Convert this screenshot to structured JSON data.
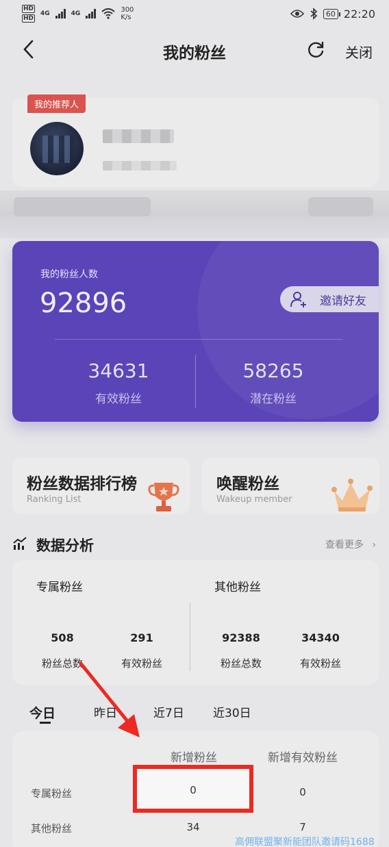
{
  "status_bar": {
    "net_hd1": "HD",
    "net_hd2": "HD",
    "net_4g1": "4G",
    "net_4g2": "4G",
    "speed_value": "300",
    "speed_unit": "K/s",
    "battery": "60",
    "time": "22:20"
  },
  "nav": {
    "title": "我的粉丝",
    "close_label": "关闭"
  },
  "referrer": {
    "tag": "我的推荐人"
  },
  "fans": {
    "label": "我的粉丝人数",
    "total": "92896",
    "invite_label": "邀请好友",
    "effective_value": "34631",
    "effective_label": "有效粉丝",
    "potential_value": "58265",
    "potential_label": "潜在粉丝"
  },
  "entries": {
    "ranking": {
      "title": "粉丝数据排行榜",
      "subtitle": "Ranking List"
    },
    "wakeup": {
      "title": "唤醒粉丝",
      "subtitle": "Wakeup member"
    }
  },
  "analysis": {
    "title": "数据分析",
    "see_more": "查看更多",
    "exclusive": {
      "header": "专属粉丝",
      "total_value": "508",
      "total_label": "粉丝总数",
      "effective_value": "291",
      "effective_label": "有效粉丝"
    },
    "other": {
      "header": "其他粉丝",
      "total_value": "92388",
      "total_label": "粉丝总数",
      "effective_value": "34340",
      "effective_label": "有效粉丝"
    }
  },
  "tabs": [
    "今日",
    "昨日",
    "近7日",
    "近30日"
  ],
  "table": {
    "col_new": "新增粉丝",
    "col_new_effective": "新增有效粉丝",
    "rows": [
      {
        "label": "专属粉丝",
        "new": "0",
        "new_effective": "0"
      },
      {
        "label": "其他粉丝",
        "new": "34",
        "new_effective": "7"
      }
    ]
  },
  "watermark": "高佣联盟聚新能团队邀请码1688"
}
